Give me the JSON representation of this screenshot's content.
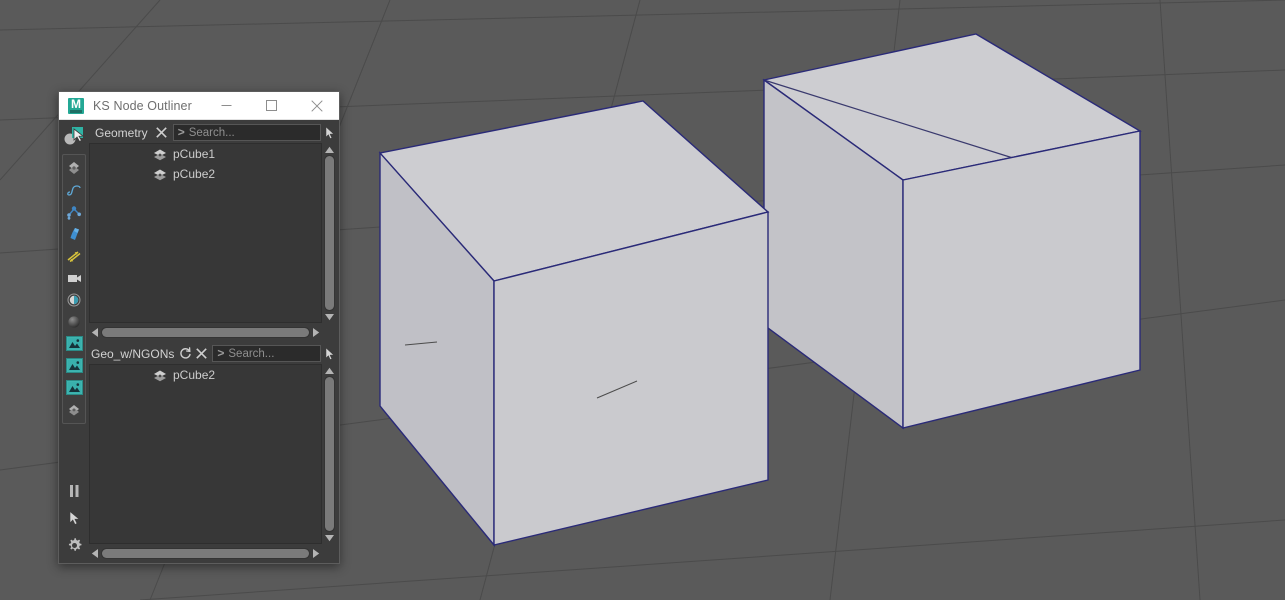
{
  "window": {
    "title": "KS Node Outliner",
    "app_icon": "maya-m-icon",
    "icon_letter": "M",
    "controls": {
      "minimize": "minimize-icon",
      "maximize": "maximize-icon",
      "close": "close-icon"
    }
  },
  "left_toolbar": {
    "top_icon": "select-pointer-sphere-icon",
    "tools": [
      {
        "name": "mesh-diamond-icon"
      },
      {
        "name": "curve-icon"
      },
      {
        "name": "joint-skeleton-icon"
      },
      {
        "name": "deformer-icon"
      },
      {
        "name": "yellow-arrows-icon"
      },
      {
        "name": "camera-icon"
      },
      {
        "name": "light-icon"
      },
      {
        "name": "shader-sphere-icon"
      },
      {
        "name": "texture-image-icon-1"
      },
      {
        "name": "texture-image-icon-2"
      },
      {
        "name": "texture-image-icon-3"
      },
      {
        "name": "mesh-diamond-small-icon"
      }
    ],
    "bottom": [
      {
        "name": "pause-icon"
      },
      {
        "name": "cursor-arrow-icon"
      },
      {
        "name": "gear-settings-icon"
      }
    ]
  },
  "panels": [
    {
      "title": "Geometry",
      "has_refresh": false,
      "refresh_icon": "refresh-circle-icon",
      "clear_icon": "clear-x-icon",
      "search_prompt": ">",
      "search_placeholder": "Search...",
      "search_value": "",
      "cursor_icon": "cursor-arrow-icon",
      "nodes": [
        {
          "label": "pCube1",
          "icon": "polygon-mesh-icon"
        },
        {
          "label": "pCube2",
          "icon": "polygon-mesh-icon"
        }
      ],
      "vscroll": {
        "thumb_top_pct": 1,
        "thumb_height_pct": 97
      },
      "hscroll": {
        "thumb_left_pct": 0,
        "thumb_width_pct": 100
      }
    },
    {
      "title": "Geo_w/NGONs",
      "has_refresh": true,
      "refresh_icon": "refresh-circle-icon",
      "clear_icon": "clear-x-icon",
      "search_prompt": ">",
      "search_placeholder": "Search...",
      "search_value": "",
      "cursor_icon": "cursor-arrow-icon",
      "nodes": [
        {
          "label": "pCube2",
          "icon": "polygon-mesh-icon"
        }
      ],
      "vscroll": {
        "thumb_top_pct": 1,
        "thumb_height_pct": 97
      },
      "hscroll": {
        "thumb_left_pct": 0,
        "thumb_width_pct": 100
      }
    }
  ],
  "viewport": {
    "background_color": "#5a5a5a",
    "grid_color": "#4a4a4a",
    "mesh_fill_color": "#c6c6ca",
    "mesh_fill_color_top": "#cdcdd1",
    "mesh_fill_color_side": "#bcbcc2",
    "selection_edge_color": "#2a2a78",
    "wire_color": "#3a3a6a",
    "objects": [
      {
        "name": "pCube1",
        "note": "left cube, quad top face"
      },
      {
        "name": "pCube2",
        "note": "right cube, top face is an NGON with interior diagonal edge"
      }
    ]
  }
}
